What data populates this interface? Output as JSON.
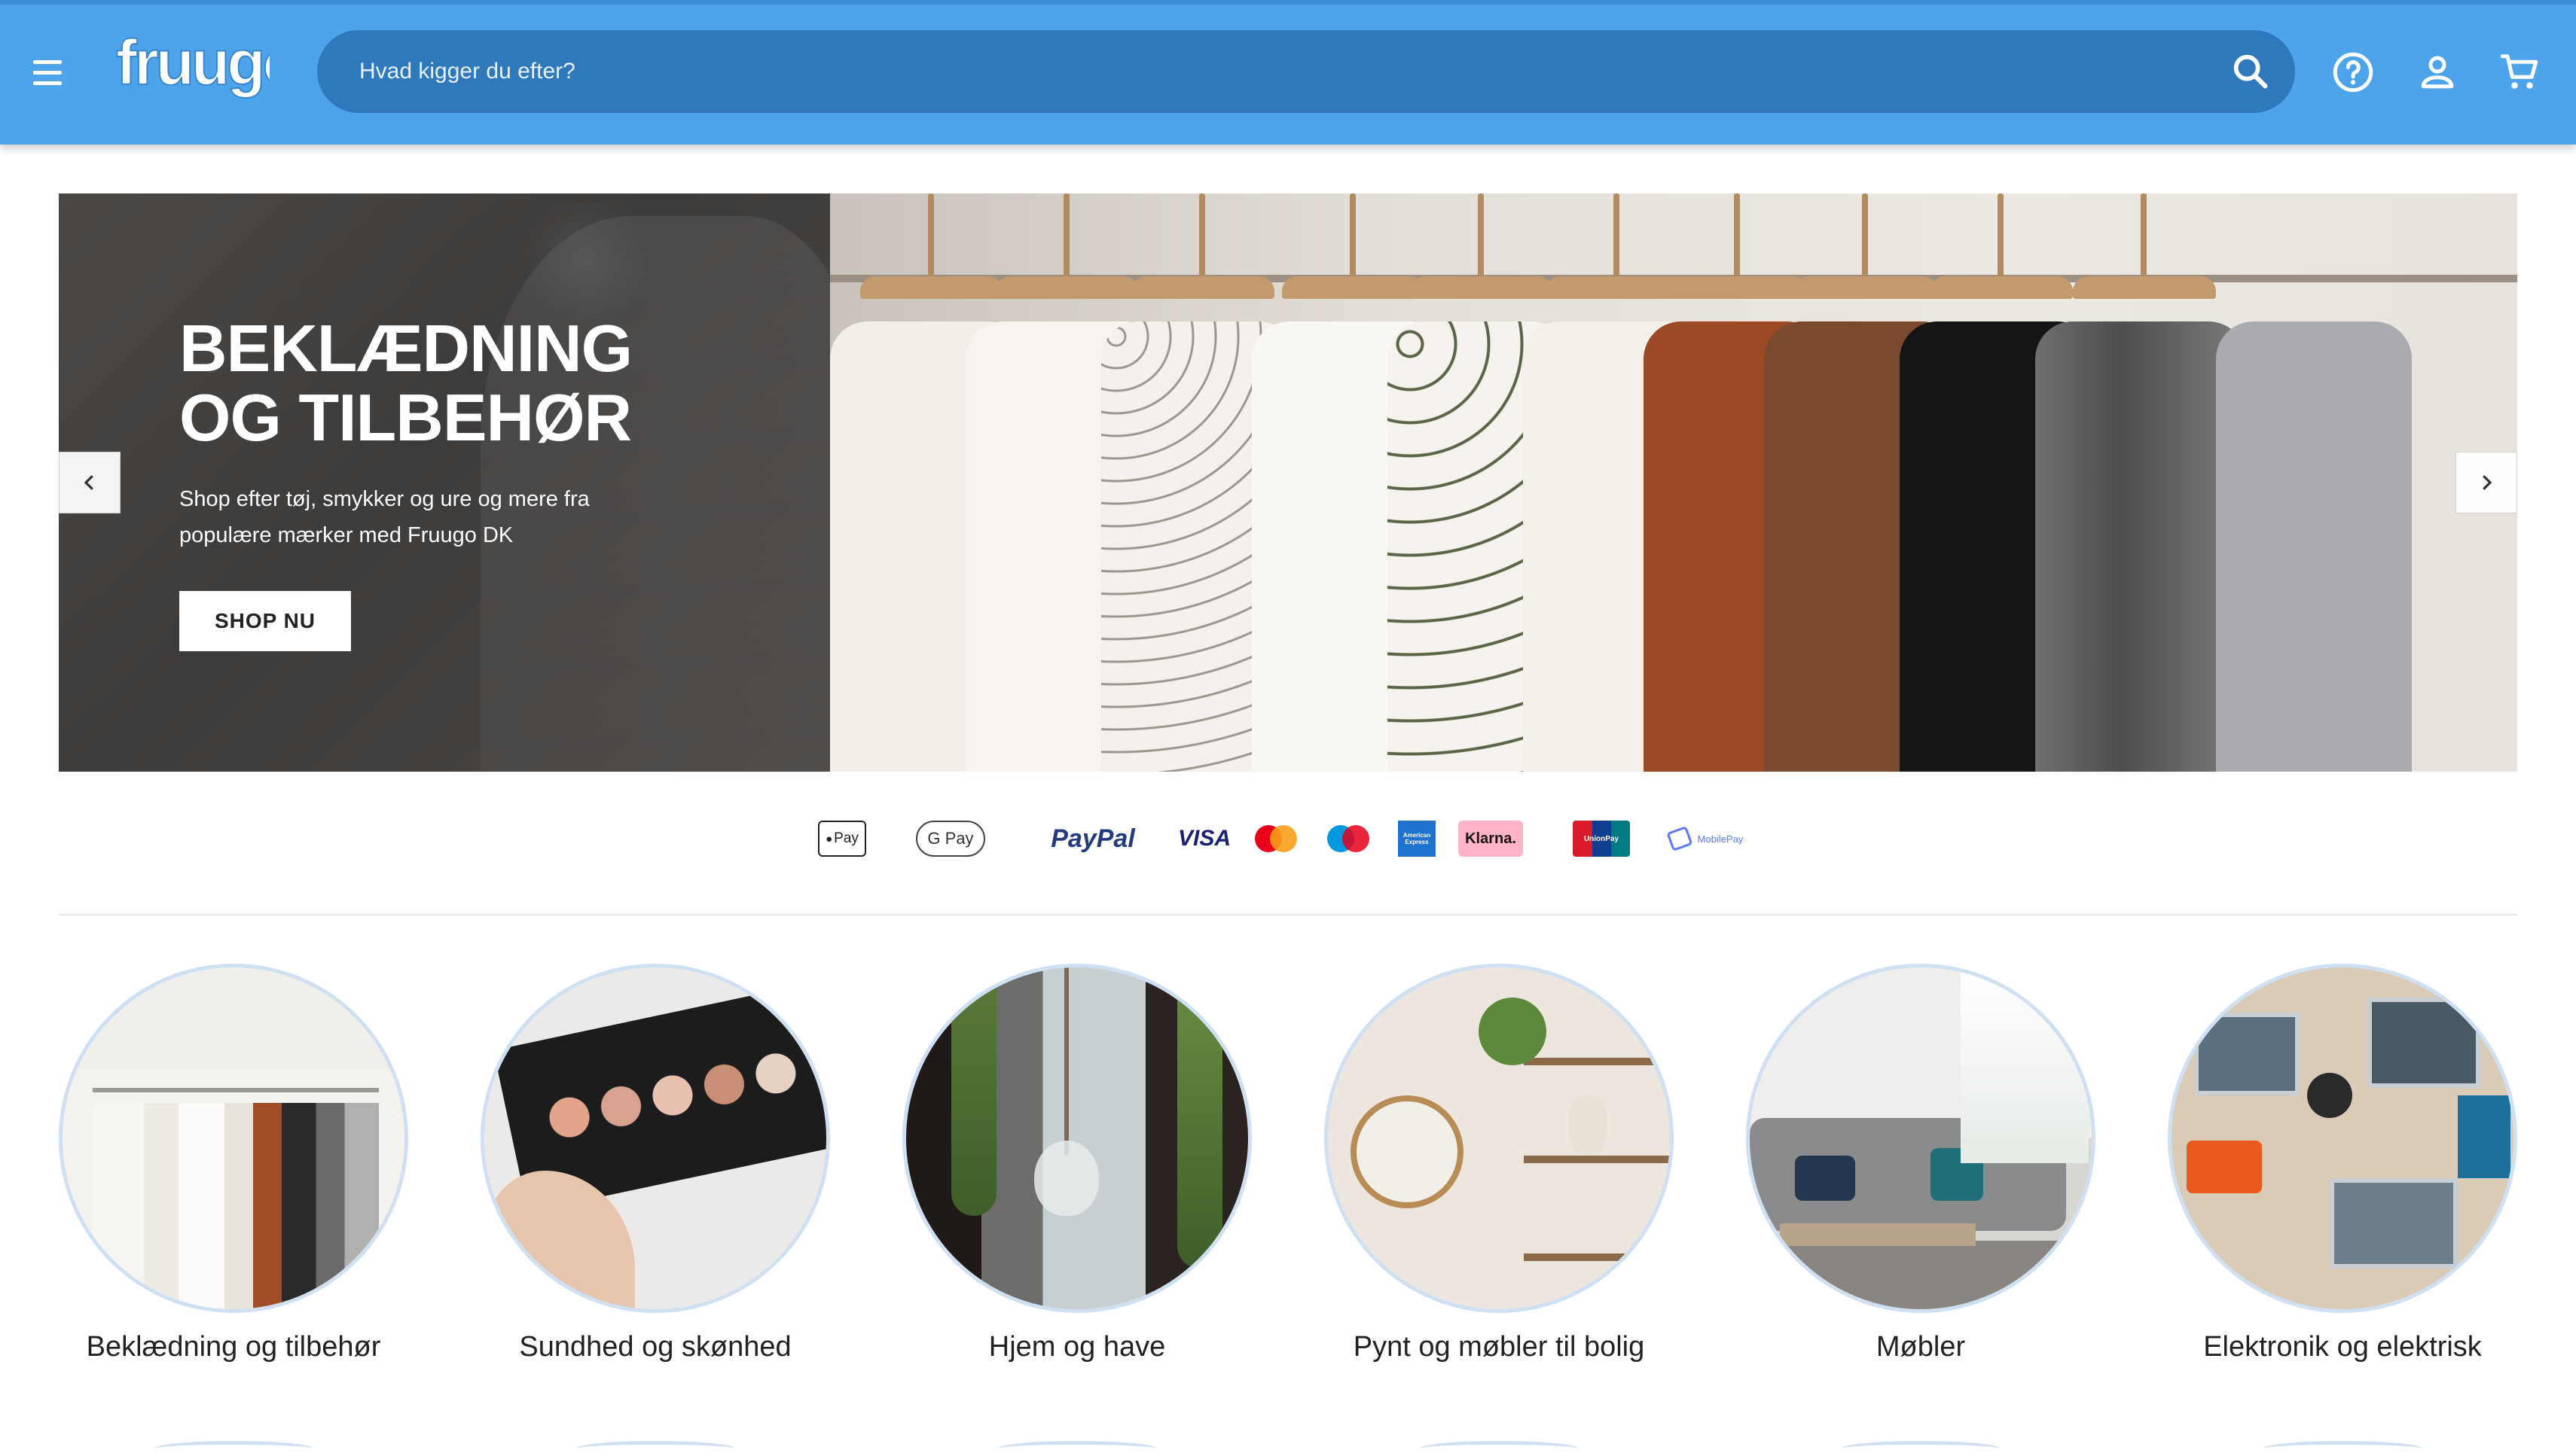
{
  "header": {
    "logo_text": "fruugo",
    "search_placeholder": "Hvad kigger du efter?",
    "icons": [
      "menu-icon",
      "search-icon",
      "help-icon",
      "account-icon",
      "cart-icon"
    ]
  },
  "hero": {
    "title_line1": "BEKLÆDNING",
    "title_line2": "OG TILBEHØR",
    "subtitle_line1": "Shop efter tøj, smykker og ure og mere fra",
    "subtitle_line2": "populære mærker med Fruugo DK",
    "cta_label": "SHOP NU"
  },
  "payments": {
    "methods": [
      {
        "label": "Pay"
      },
      {
        "label": "G Pay"
      },
      {
        "label": "PayPal"
      },
      {
        "label": "VISA"
      },
      {
        "label": "Mastercard"
      },
      {
        "label": "Maestro"
      },
      {
        "label": "American Express"
      },
      {
        "label": "Klarna."
      },
      {
        "label": "UnionPay"
      },
      {
        "label": "MobilePay"
      }
    ]
  },
  "categories": [
    {
      "label": "Beklædning og tilbehør"
    },
    {
      "label": "Sundhed og skønhed"
    },
    {
      "label": "Hjem og have"
    },
    {
      "label": "Pynt og møbler til bolig"
    },
    {
      "label": "Møbler"
    },
    {
      "label": "Elektronik og elektrisk"
    }
  ],
  "colors": {
    "header_bg": "#4ea4ea",
    "search_bg": "#2f78bb",
    "circle_border": "#cfe0f3"
  }
}
